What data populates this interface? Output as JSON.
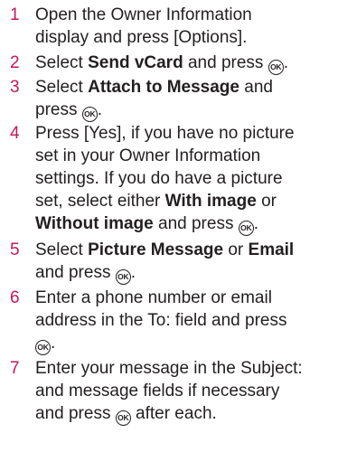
{
  "accent_color": "#c2185b",
  "text_color": "#231f20",
  "ok_key_text": "OK",
  "steps": [
    {
      "num": "1",
      "l1": "Open the Owner Information",
      "l2": "display and press [Options]."
    },
    {
      "num": "2",
      "pre": "Select ",
      "b1": "Send vCard",
      "post": " and press "
    },
    {
      "num": "3",
      "pre": "Select ",
      "b1": "Attach to Message",
      "post": " and",
      "l2": "press "
    },
    {
      "num": "4",
      "l1": "Press [Yes], if you have no picture",
      "l2": "set in your Owner Information",
      "l3": "settings. If you do have a picture",
      "l4pre": "set, select either ",
      "b1": "With image",
      "l4post": " or",
      "b2": "Without image",
      "l5post": " and press "
    },
    {
      "num": "5",
      "pre": "Select ",
      "b1": "Picture Message",
      "mid": " or ",
      "b2": "Email",
      "l2": "and press "
    },
    {
      "num": "6",
      "l1": "Enter a phone number or email",
      "l2": "address in the To: field and press"
    },
    {
      "num": "7",
      "l1": "Enter your message in the Subject:",
      "l2": "and message fields if necessary",
      "l3pre": "and press ",
      "l3post": " after each."
    }
  ]
}
